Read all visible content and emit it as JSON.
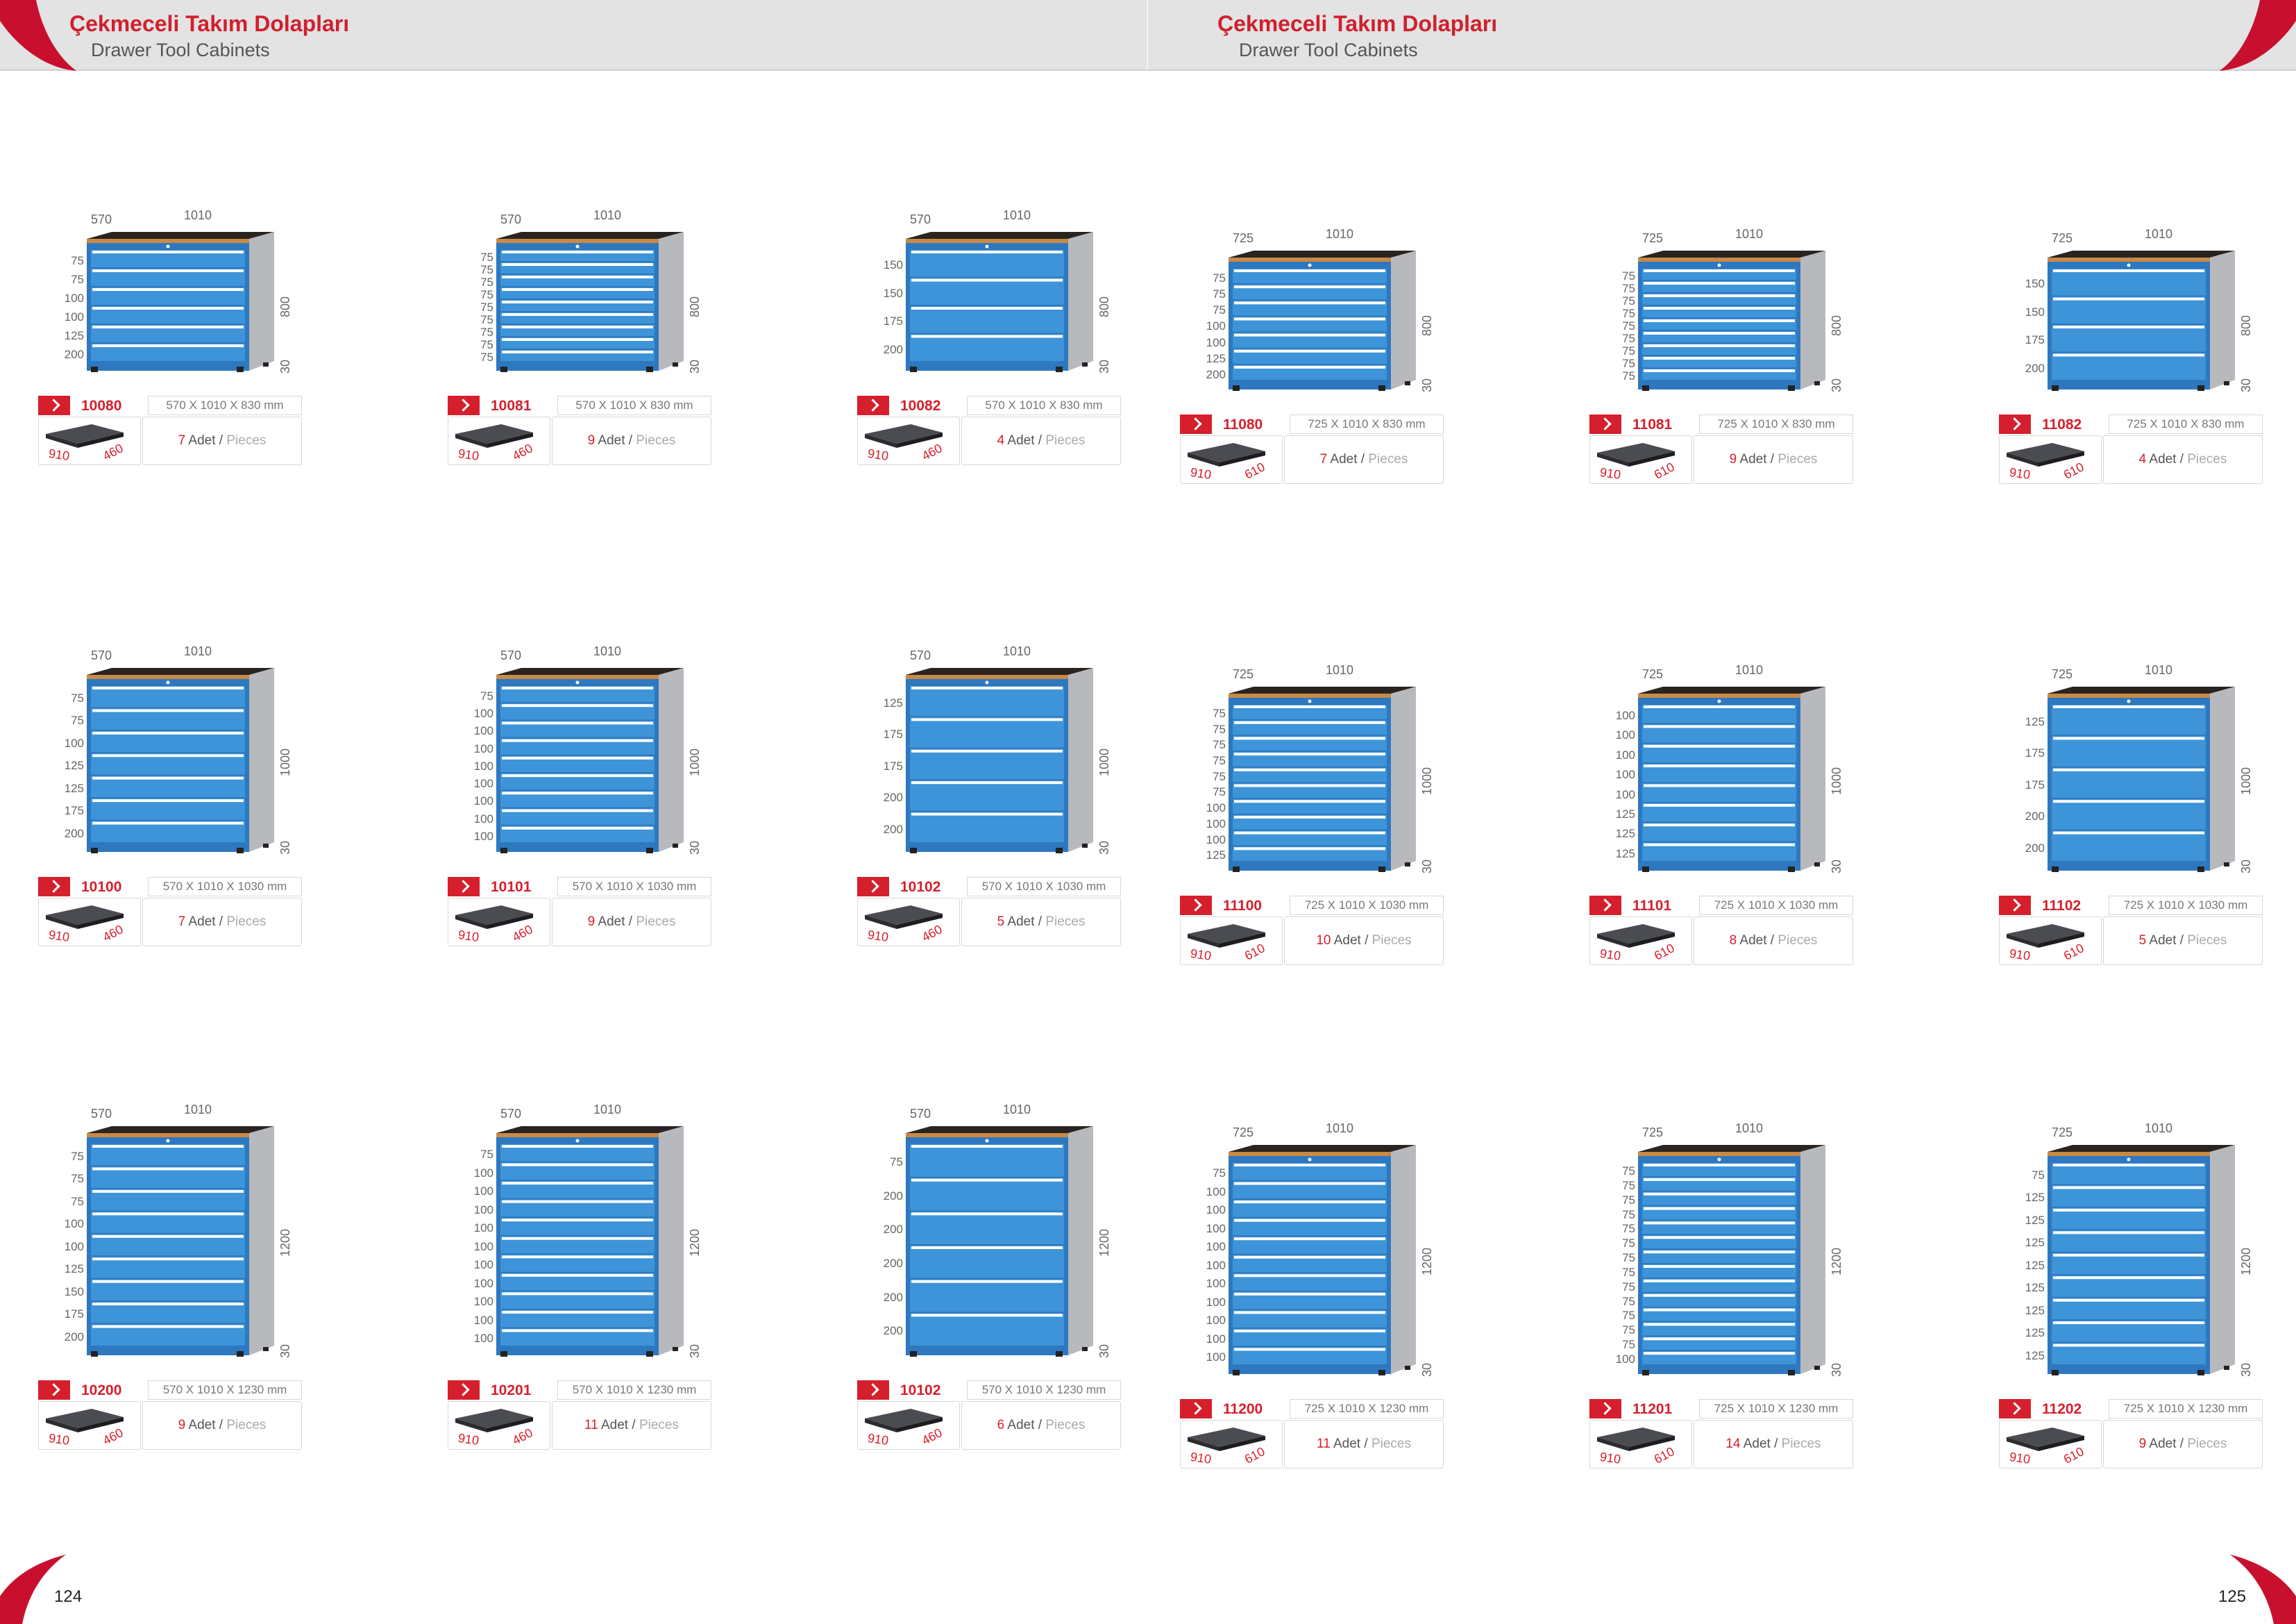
{
  "header": {
    "left": {
      "title": "Çekmeceli Takım Dolapları",
      "subtitle": "Drawer Tool Cabinets"
    },
    "right": {
      "title": "Çekmeceli Takım Dolapları",
      "subtitle": "Drawer Tool Cabinets"
    }
  },
  "pages": {
    "left": "124",
    "right": "125"
  },
  "labels": {
    "adet": "Adet",
    "slash": "/",
    "pieces": "Pieces"
  },
  "colors": {
    "accent": "#d61f2c",
    "cabinet_blue": "#3d94d8",
    "body_grey": "#a9abb0"
  },
  "products": [
    {
      "code": "10080",
      "size": "570 X 1010 X 830 mm",
      "count": "7",
      "depth": "570",
      "width": "1010",
      "height": "800",
      "foot": "30",
      "drawers": [
        "75",
        "75",
        "100",
        "100",
        "125",
        "200"
      ],
      "tray": [
        "910",
        "460"
      ]
    },
    {
      "code": "10081",
      "size": "570 X 1010 X 830 mm",
      "count": "9",
      "depth": "570",
      "width": "1010",
      "height": "800",
      "foot": "30",
      "drawers": [
        "75",
        "75",
        "75",
        "75",
        "75",
        "75",
        "75",
        "75",
        "75"
      ],
      "tray": [
        "910",
        "460"
      ]
    },
    {
      "code": "10082",
      "size": "570 X 1010 X 830 mm",
      "count": "4",
      "depth": "570",
      "width": "1010",
      "height": "800",
      "foot": "30",
      "drawers": [
        "150",
        "150",
        "175",
        "200"
      ],
      "tray": [
        "910",
        "460"
      ]
    },
    {
      "code": "11080",
      "size": "725 X 1010 X 830 mm",
      "count": "7",
      "depth": "725",
      "width": "1010",
      "height": "800",
      "foot": "30",
      "drawers": [
        "75",
        "75",
        "75",
        "100",
        "100",
        "125",
        "200"
      ],
      "tray": [
        "910",
        "610"
      ]
    },
    {
      "code": "11081",
      "size": "725 X 1010 X 830 mm",
      "count": "9",
      "depth": "725",
      "width": "1010",
      "height": "800",
      "foot": "30",
      "drawers": [
        "75",
        "75",
        "75",
        "75",
        "75",
        "75",
        "75",
        "75",
        "75"
      ],
      "tray": [
        "910",
        "610"
      ]
    },
    {
      "code": "11082",
      "size": "725 X 1010 X 830 mm",
      "count": "4",
      "depth": "725",
      "width": "1010",
      "height": "800",
      "foot": "30",
      "drawers": [
        "150",
        "150",
        "175",
        "200"
      ],
      "tray": [
        "910",
        "610"
      ]
    },
    {
      "code": "10100",
      "size": "570 X 1010 X 1030 mm",
      "count": "7",
      "depth": "570",
      "width": "1010",
      "height": "1000",
      "foot": "30",
      "drawers": [
        "75",
        "75",
        "100",
        "125",
        "125",
        "175",
        "200"
      ],
      "tray": [
        "910",
        "460"
      ]
    },
    {
      "code": "10101",
      "size": "570 X 1010 X 1030 mm",
      "count": "9",
      "depth": "570",
      "width": "1010",
      "height": "1000",
      "foot": "30",
      "drawers": [
        "75",
        "100",
        "100",
        "100",
        "100",
        "100",
        "100",
        "100",
        "100"
      ],
      "tray": [
        "910",
        "460"
      ]
    },
    {
      "code": "10102",
      "size": "570 X 1010 X 1030 mm",
      "count": "5",
      "depth": "570",
      "width": "1010",
      "height": "1000",
      "foot": "30",
      "drawers": [
        "125",
        "175",
        "175",
        "200",
        "200"
      ],
      "tray": [
        "910",
        "460"
      ]
    },
    {
      "code": "11100",
      "size": "725 X 1010 X 1030 mm",
      "count": "10",
      "depth": "725",
      "width": "1010",
      "height": "1000",
      "foot": "30",
      "drawers": [
        "75",
        "75",
        "75",
        "75",
        "75",
        "75",
        "100",
        "100",
        "100",
        "125"
      ],
      "tray": [
        "910",
        "610"
      ]
    },
    {
      "code": "11101",
      "size": "725 X 1010 X 1030 mm",
      "count": "8",
      "depth": "725",
      "width": "1010",
      "height": "1000",
      "foot": "30",
      "drawers": [
        "100",
        "100",
        "100",
        "100",
        "100",
        "125",
        "125",
        "125"
      ],
      "tray": [
        "910",
        "610"
      ]
    },
    {
      "code": "11102",
      "size": "725 X 1010 X 1030 mm",
      "count": "5",
      "depth": "725",
      "width": "1010",
      "height": "1000",
      "foot": "30",
      "drawers": [
        "125",
        "175",
        "175",
        "200",
        "200"
      ],
      "tray": [
        "910",
        "610"
      ]
    },
    {
      "code": "10200",
      "size": "570 X 1010 X 1230 mm",
      "count": "9",
      "depth": "570",
      "width": "1010",
      "height": "1200",
      "foot": "30",
      "drawers": [
        "75",
        "75",
        "75",
        "100",
        "100",
        "125",
        "150",
        "175",
        "200"
      ],
      "tray": [
        "910",
        "460"
      ]
    },
    {
      "code": "10201",
      "size": "570 X 1010 X 1230 mm",
      "count": "11",
      "depth": "570",
      "width": "1010",
      "height": "1200",
      "foot": "30",
      "drawers": [
        "75",
        "100",
        "100",
        "100",
        "100",
        "100",
        "100",
        "100",
        "100",
        "100",
        "100"
      ],
      "tray": [
        "910",
        "460"
      ]
    },
    {
      "code": "10102",
      "size": "570 X 1010 X 1230 mm",
      "count": "6",
      "depth": "570",
      "width": "1010",
      "height": "1200",
      "foot": "30",
      "drawers": [
        "75",
        "200",
        "200",
        "200",
        "200",
        "200"
      ],
      "tray": [
        "910",
        "460"
      ]
    },
    {
      "code": "11200",
      "size": "725 X 1010 X 1230 mm",
      "count": "11",
      "depth": "725",
      "width": "1010",
      "height": "1200",
      "foot": "30",
      "drawers": [
        "75",
        "100",
        "100",
        "100",
        "100",
        "100",
        "100",
        "100",
        "100",
        "100",
        "100"
      ],
      "tray": [
        "910",
        "610"
      ]
    },
    {
      "code": "11201",
      "size": "725 X 1010 X 1230 mm",
      "count": "14",
      "depth": "725",
      "width": "1010",
      "height": "1200",
      "foot": "30",
      "drawers": [
        "75",
        "75",
        "75",
        "75",
        "75",
        "75",
        "75",
        "75",
        "75",
        "75",
        "75",
        "75",
        "75",
        "100"
      ],
      "tray": [
        "910",
        "610"
      ]
    },
    {
      "code": "11202",
      "size": "725 X 1010 X 1230 mm",
      "count": "9",
      "depth": "725",
      "width": "1010",
      "height": "1200",
      "foot": "30",
      "drawers": [
        "75",
        "125",
        "125",
        "125",
        "125",
        "125",
        "125",
        "125",
        "125"
      ],
      "tray": [
        "910",
        "610"
      ]
    }
  ]
}
